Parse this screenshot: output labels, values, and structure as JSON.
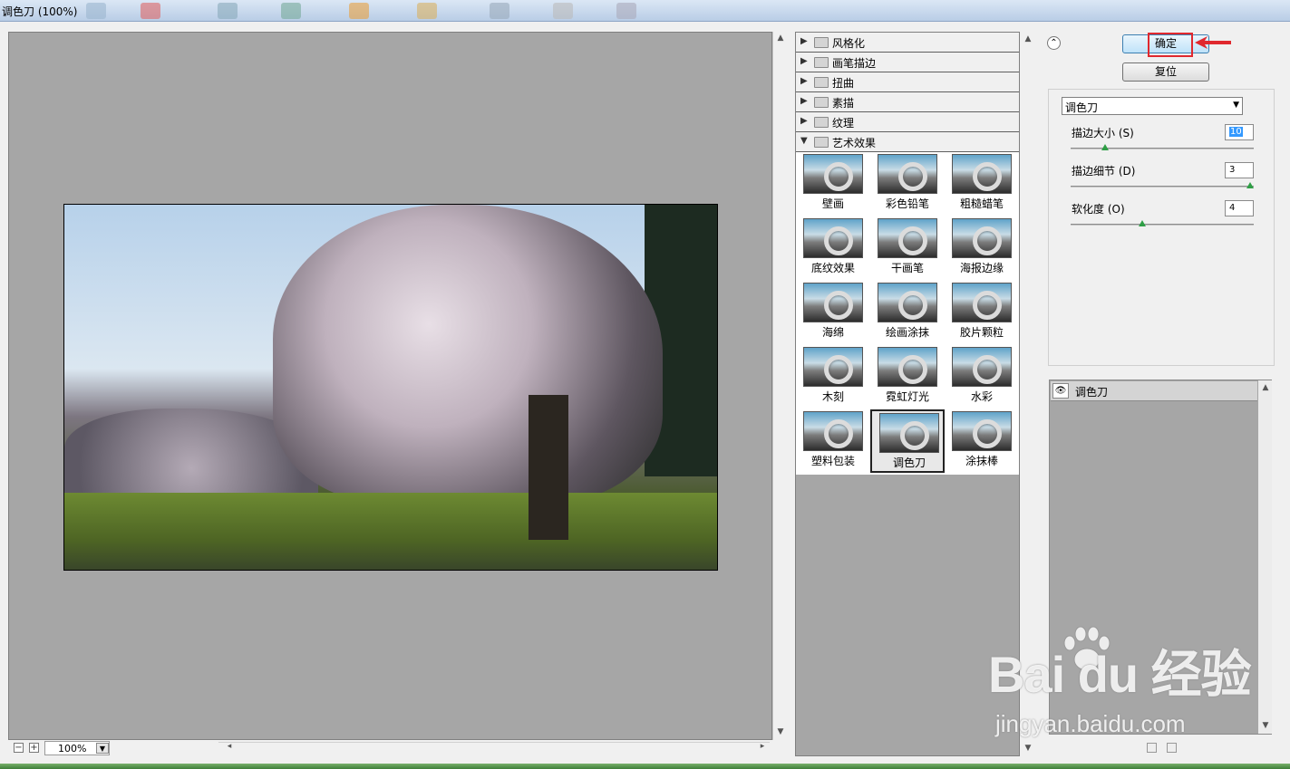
{
  "window": {
    "title": "调色刀 (100%)"
  },
  "preview": {
    "zoom": "100%"
  },
  "filter_gallery": {
    "categories": [
      {
        "label": "风格化",
        "expanded": false
      },
      {
        "label": "画笔描边",
        "expanded": false
      },
      {
        "label": "扭曲",
        "expanded": false
      },
      {
        "label": "素描",
        "expanded": false
      },
      {
        "label": "纹理",
        "expanded": false
      },
      {
        "label": "艺术效果",
        "expanded": true
      }
    ],
    "thumbnails": [
      "壁画",
      "彩色铅笔",
      "粗糙蜡笔",
      "底纹效果",
      "干画笔",
      "海报边缘",
      "海绵",
      "绘画涂抹",
      "胶片颗粒",
      "木刻",
      "霓虹灯光",
      "水彩",
      "塑料包装",
      "调色刀",
      "涂抹棒"
    ],
    "selected": "调色刀"
  },
  "buttons": {
    "ok": "确定",
    "reset": "复位"
  },
  "settings": {
    "filter": "调色刀",
    "params": [
      {
        "label": "描边大小 (S)",
        "value": "10",
        "fraction": 0.19
      },
      {
        "label": "描边细节 (D)",
        "value": "3",
        "fraction": 1.0
      },
      {
        "label": "软化度 (O)",
        "value": "4",
        "fraction": 0.4
      }
    ]
  },
  "layers": {
    "items": [
      "调色刀"
    ]
  },
  "watermark": {
    "logo": "Bai du 经验",
    "url": "jingyan.baidu.com"
  },
  "colors": {
    "highlight": "#e0282e",
    "selected_border": "#222222",
    "preview_bg": "#a6a6a6"
  }
}
